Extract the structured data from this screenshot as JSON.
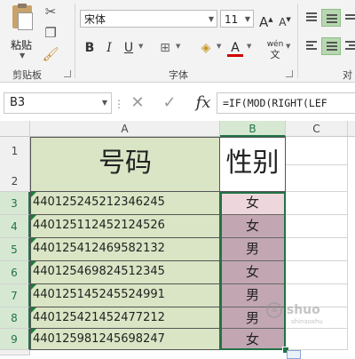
{
  "ribbon": {
    "paste_label": "粘贴",
    "clipboard_group": "剪贴板",
    "font_group": "字体",
    "align_group_partial": "对",
    "font_name": "宋体",
    "font_size": "11",
    "grow_font": "A",
    "shrink_font": "A",
    "bold": "B",
    "italic": "I",
    "underline": "U",
    "font_color": "A",
    "phonetic": "wén"
  },
  "formula_bar": {
    "name_box": "B3",
    "fx": "fx",
    "formula": "=IF(MOD(RIGHT(LEF"
  },
  "sheet": {
    "columns": [
      "A",
      "B",
      "C"
    ],
    "rows": [
      "1",
      "2",
      "3",
      "4",
      "5",
      "6",
      "7",
      "8",
      "9"
    ],
    "header_a": "号码",
    "header_b": "性别",
    "records": [
      {
        "id": "440125245212346245",
        "gender": "女"
      },
      {
        "id": "440125112452124526",
        "gender": "女"
      },
      {
        "id": "440125412469582132",
        "gender": "男"
      },
      {
        "id": "440125469824512345",
        "gender": "女"
      },
      {
        "id": "440125145245524991",
        "gender": "男"
      },
      {
        "id": "440125421452477212",
        "gender": "男"
      },
      {
        "id": "440125981245698247",
        "gender": "女"
      }
    ]
  },
  "colors": {
    "header_fill": "#d9e5c4",
    "gender_fill": "#c2a7b2",
    "gender_first_fill": "#eed7dc",
    "selection": "#217346"
  },
  "watermark": {
    "text": "shuo",
    "sub": "shinaoxhu"
  }
}
